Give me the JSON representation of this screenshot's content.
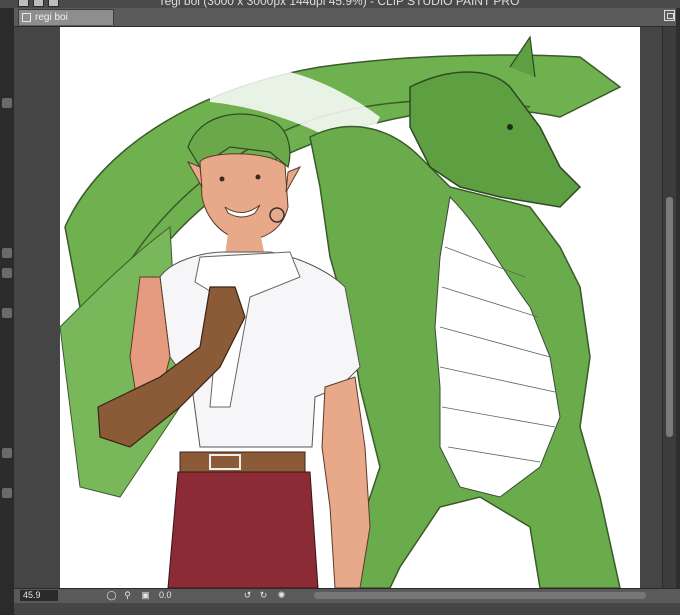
{
  "window": {
    "title": "regi boi (3000 x 3000px 144dpi 45.9%)  - CLIP STUDIO PAINT PRO"
  },
  "tabs": [
    {
      "label": "regi boi"
    }
  ],
  "status": {
    "zoom": "45.9",
    "angle": "0.0"
  },
  "icons": {
    "window": [
      "close-icon",
      "minimize-icon",
      "maximize-icon"
    ],
    "statusbar": [
      "zoom-out-icon",
      "zoom-in-icon",
      "fit-canvas-icon",
      "rotate-left-icon",
      "rotate-right-icon",
      "reset-rotation-icon"
    ]
  },
  "colors": {
    "dragon_green": "#6fb04f",
    "hair_green": "#6aa84a",
    "skin": "#e8a88a",
    "pants": "#8a2b35",
    "glove": "#8b5a36",
    "shirt": "#f6f6f8"
  }
}
